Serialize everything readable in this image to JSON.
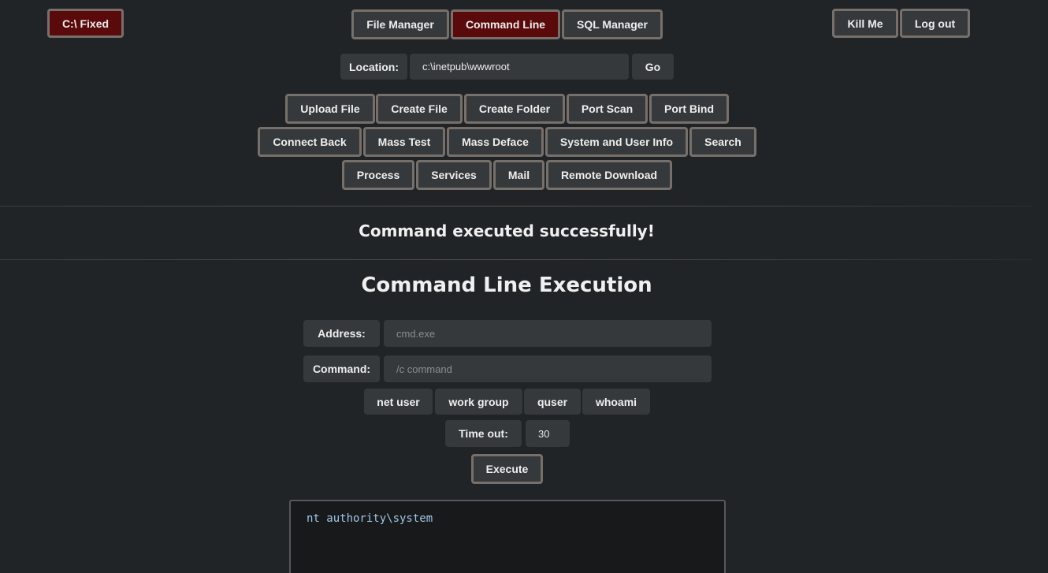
{
  "drive_button": "C:\\ Fixed",
  "tabs": [
    {
      "label": "File Manager",
      "active": false
    },
    {
      "label": "Command Line",
      "active": true
    },
    {
      "label": "SQL Manager",
      "active": false
    }
  ],
  "account": {
    "kill_label": "Kill Me",
    "logout_label": "Log out"
  },
  "location": {
    "label": "Location:",
    "value": "c:\\inetpub\\wwwroot",
    "go_label": "Go"
  },
  "toolbar": {
    "row1": [
      "Upload File",
      "Create File",
      "Create Folder",
      "Port Scan",
      "Port Bind"
    ],
    "row2": [
      "Connect Back",
      "Mass Test",
      "Mass Deface",
      "System and User Info",
      "Search"
    ],
    "row3": [
      "Process",
      "Services",
      "Mail",
      "Remote Download"
    ]
  },
  "status_message": "Command executed successfully!",
  "section_title": "Command Line Execution",
  "form": {
    "address_label": "Address:",
    "address_placeholder": "cmd.exe",
    "command_label": "Command:",
    "command_placeholder": "/c command",
    "quick_commands": [
      "net user",
      "work group",
      "quser",
      "whoami"
    ],
    "timeout_label": "Time out:",
    "timeout_value": "30",
    "execute_label": "Execute"
  },
  "output_text": "nt authority\\system",
  "colors": {
    "active_tab": "#5a0a0a",
    "background": "#212426",
    "output_text": "#9fc6e6"
  }
}
